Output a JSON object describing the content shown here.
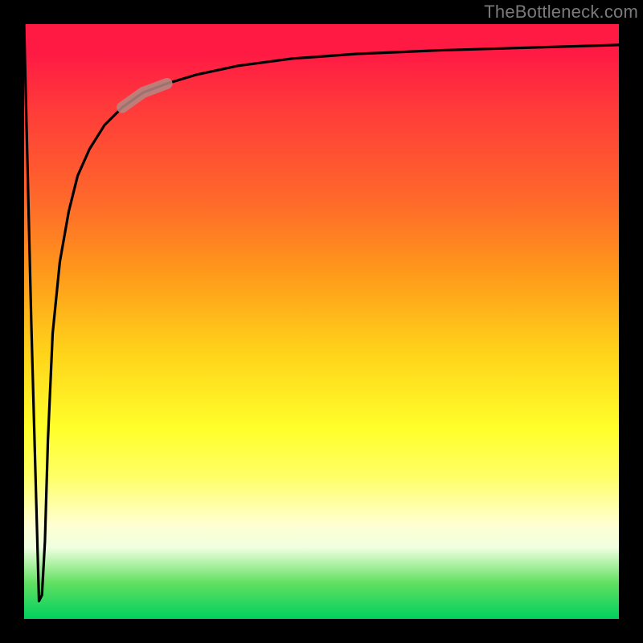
{
  "watermark": "TheBottleneck.com",
  "colors": {
    "frame": "#000000",
    "gradient_top": "#ff1a44",
    "gradient_bottom": "#00d060",
    "curve": "#000000",
    "highlight": "#b58984"
  },
  "chart_data": {
    "type": "line",
    "title": "",
    "xlabel": "",
    "ylabel": "",
    "xlim": [
      0,
      1
    ],
    "ylim": [
      0,
      1
    ],
    "series": [
      {
        "name": "curve",
        "x": [
          0.0,
          0.012,
          0.025,
          0.03,
          0.035,
          0.04,
          0.048,
          0.06,
          0.075,
          0.09,
          0.11,
          0.135,
          0.165,
          0.2,
          0.24,
          0.29,
          0.36,
          0.45,
          0.56,
          0.7,
          0.9,
          1.0
        ],
        "y": [
          1.0,
          0.5,
          0.03,
          0.04,
          0.13,
          0.3,
          0.48,
          0.6,
          0.685,
          0.745,
          0.79,
          0.83,
          0.86,
          0.885,
          0.9,
          0.915,
          0.93,
          0.942,
          0.95,
          0.956,
          0.962,
          0.965
        ]
      }
    ],
    "highlight_segment": {
      "x_start": 0.165,
      "x_end": 0.24
    },
    "legend": false,
    "grid": false,
    "axes_visible": false
  }
}
